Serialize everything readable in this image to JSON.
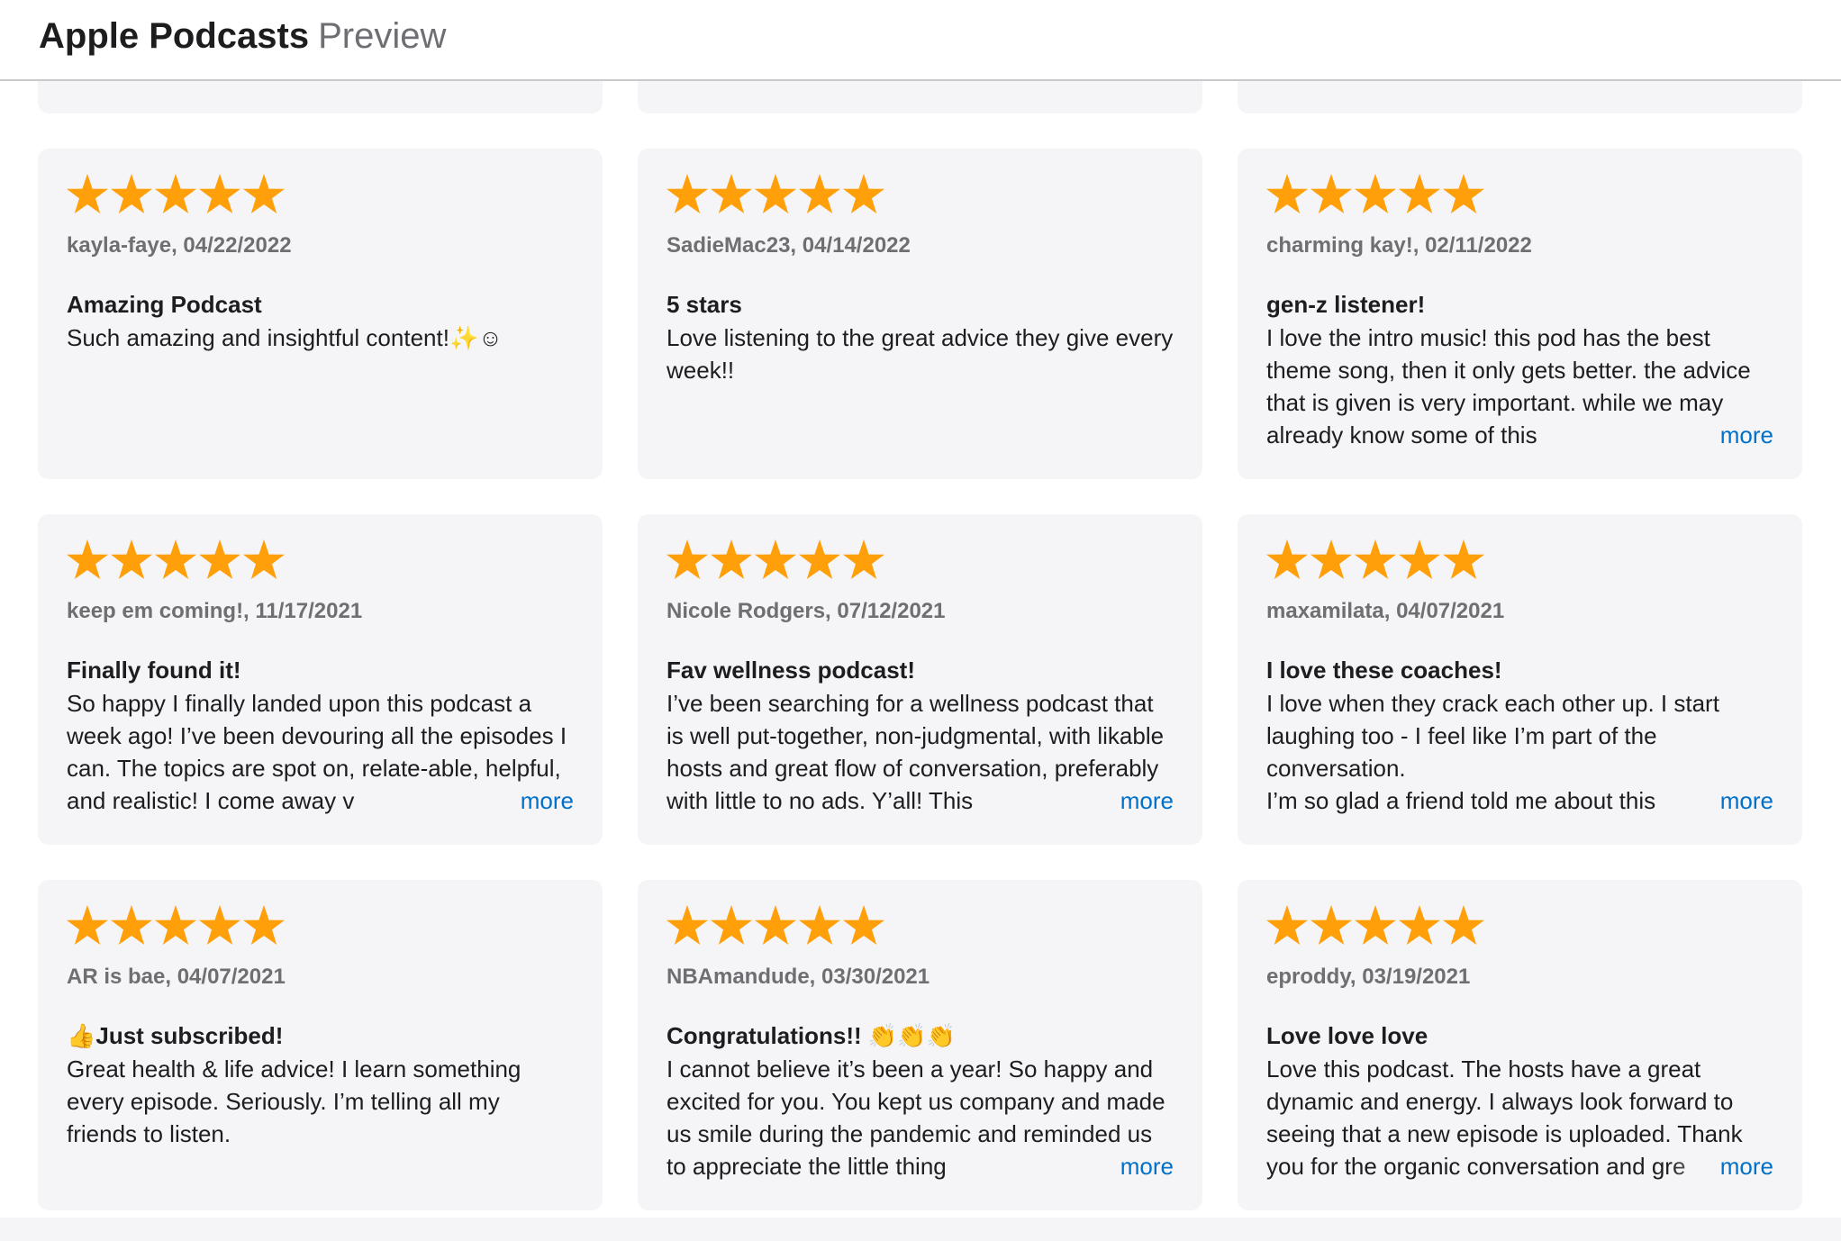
{
  "header": {
    "brand_name": "Apple Podcasts",
    "brand_sub": "Preview"
  },
  "colors": {
    "star": "#ff9f0a",
    "link": "#0070c9",
    "card_bg": "#f5f5f7"
  },
  "reviews": [
    {
      "rating": 5,
      "author_date": "kayla-faye, 04/22/2022",
      "title": "Amazing Podcast",
      "body": "Such amazing and insightful content!✨☺",
      "more": ""
    },
    {
      "rating": 5,
      "author_date": "SadieMac23, 04/14/2022",
      "title": "5 stars",
      "body": "Love listening to the great advice they give every week!!",
      "more": ""
    },
    {
      "rating": 5,
      "author_date": "charming kay!, 02/11/2022",
      "title": "gen-z listener!",
      "body": "I love the intro music! this pod has the best theme song, then it only gets better. the advice that is given is very important. while we may already know some of this",
      "more": "more"
    },
    {
      "rating": 5,
      "author_date": "keep em coming!, 11/17/2021",
      "title": "Finally found it!",
      "body": "So happy I finally landed upon this podcast a week ago! I’ve been devouring all the episodes I can. The topics are spot on, relate-able, helpful, and realistic! I come away v",
      "more": "more"
    },
    {
      "rating": 5,
      "author_date": "Nicole Rodgers, 07/12/2021",
      "title": "Fav wellness podcast!",
      "body": "I’ve been searching for a wellness podcast that is well put-together, non-judgmental, with likable hosts and great flow of conversation, preferably with little to no ads. Y’all! This",
      "more": "more"
    },
    {
      "rating": 5,
      "author_date": "maxamilata, 04/07/2021",
      "title": "I love these coaches!",
      "body": "I love when they crack each other up. I start laughing too - I feel like I’m part of the conversation.\nI’m so glad a friend told me about this",
      "more": "more"
    },
    {
      "rating": 5,
      "author_date": "AR is bae, 04/07/2021",
      "title": "👍Just subscribed!",
      "body": "Great health & life advice! I learn something every episode. Seriously. I’m telling all my friends to listen.",
      "more": ""
    },
    {
      "rating": 5,
      "author_date": "NBAmandude, 03/30/2021",
      "title": "Congratulations!! 👏👏👏",
      "body": "I cannot believe it’s been a year! So happy and excited for you. You kept us company and made us smile during the pandemic and reminded us to appreciate the little thing",
      "more": "more"
    },
    {
      "rating": 5,
      "author_date": "eproddy, 03/19/2021",
      "title": "Love love love",
      "body": "Love this podcast. The hosts have a great dynamic and energy. I always look forward to seeing that a new episode is uploaded. Thank you for the organic conversation and gre",
      "more": "more"
    }
  ]
}
